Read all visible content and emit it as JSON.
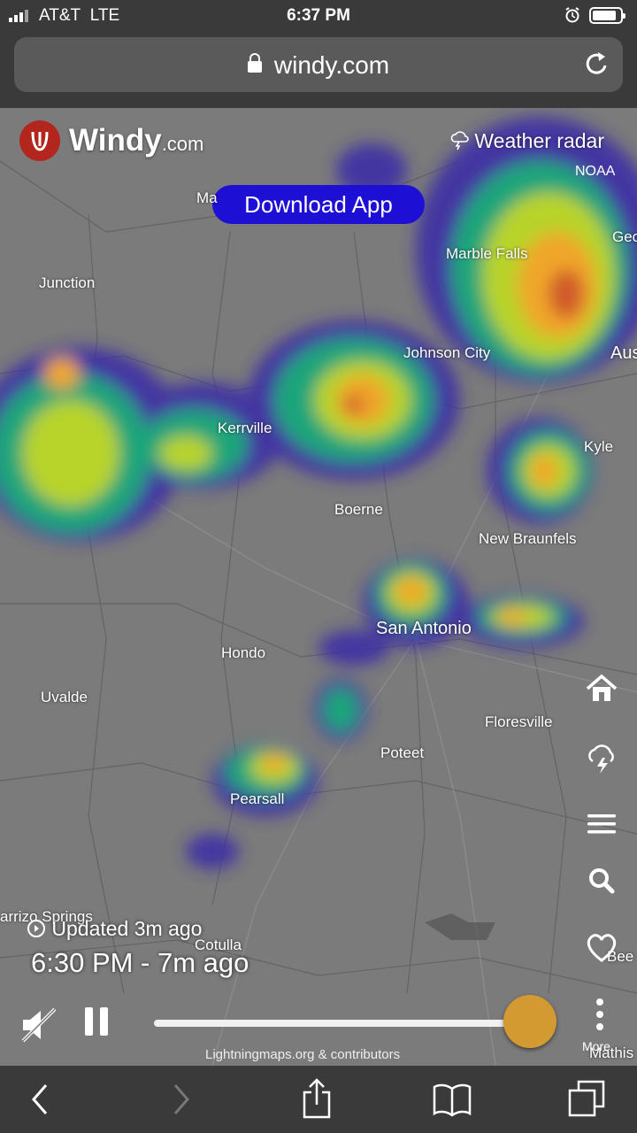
{
  "status_bar": {
    "carrier": "AT&T",
    "network": "LTE",
    "time": "6:37 PM"
  },
  "browser": {
    "url": "windy.com"
  },
  "map": {
    "brand": "Windy",
    "brand_suffix": ".com",
    "download_button": "Download App",
    "layer": "Weather radar",
    "source": "NOAA",
    "cities": [
      {
        "name": "Ma"
      },
      {
        "name": "Junction"
      },
      {
        "name": "Marble Falls"
      },
      {
        "name": "Geo"
      },
      {
        "name": "Johnson City"
      },
      {
        "name": "Aus"
      },
      {
        "name": "Kerrville"
      },
      {
        "name": "Kyle"
      },
      {
        "name": "Boerne"
      },
      {
        "name": "New Braunfels"
      },
      {
        "name": "San Antonio"
      },
      {
        "name": "Hondo"
      },
      {
        "name": "Uvalde"
      },
      {
        "name": "Floresville"
      },
      {
        "name": "Poteet"
      },
      {
        "name": "Pearsall"
      },
      {
        "name": "arrizo Springs"
      },
      {
        "name": "Cotulla"
      },
      {
        "name": "Bee"
      },
      {
        "name": "Mathis"
      }
    ],
    "updated": "Updated 3m ago",
    "timestamp": "6:30 PM - 7m ago",
    "credit": "Lightningmaps.org & contributors",
    "more_label": "More",
    "timeline_progress": 1.0
  },
  "colors": {
    "accent": "#1d10d4",
    "brand": "#b3261e",
    "knob": "#d49a32"
  },
  "icons": [
    "home-icon",
    "lightning-icon",
    "menu-icon",
    "search-icon",
    "heart-icon",
    "more-icon",
    "mute-icon",
    "pause-icon",
    "back-icon",
    "forward-icon",
    "share-icon",
    "bookmarks-icon",
    "tabs-icon"
  ]
}
